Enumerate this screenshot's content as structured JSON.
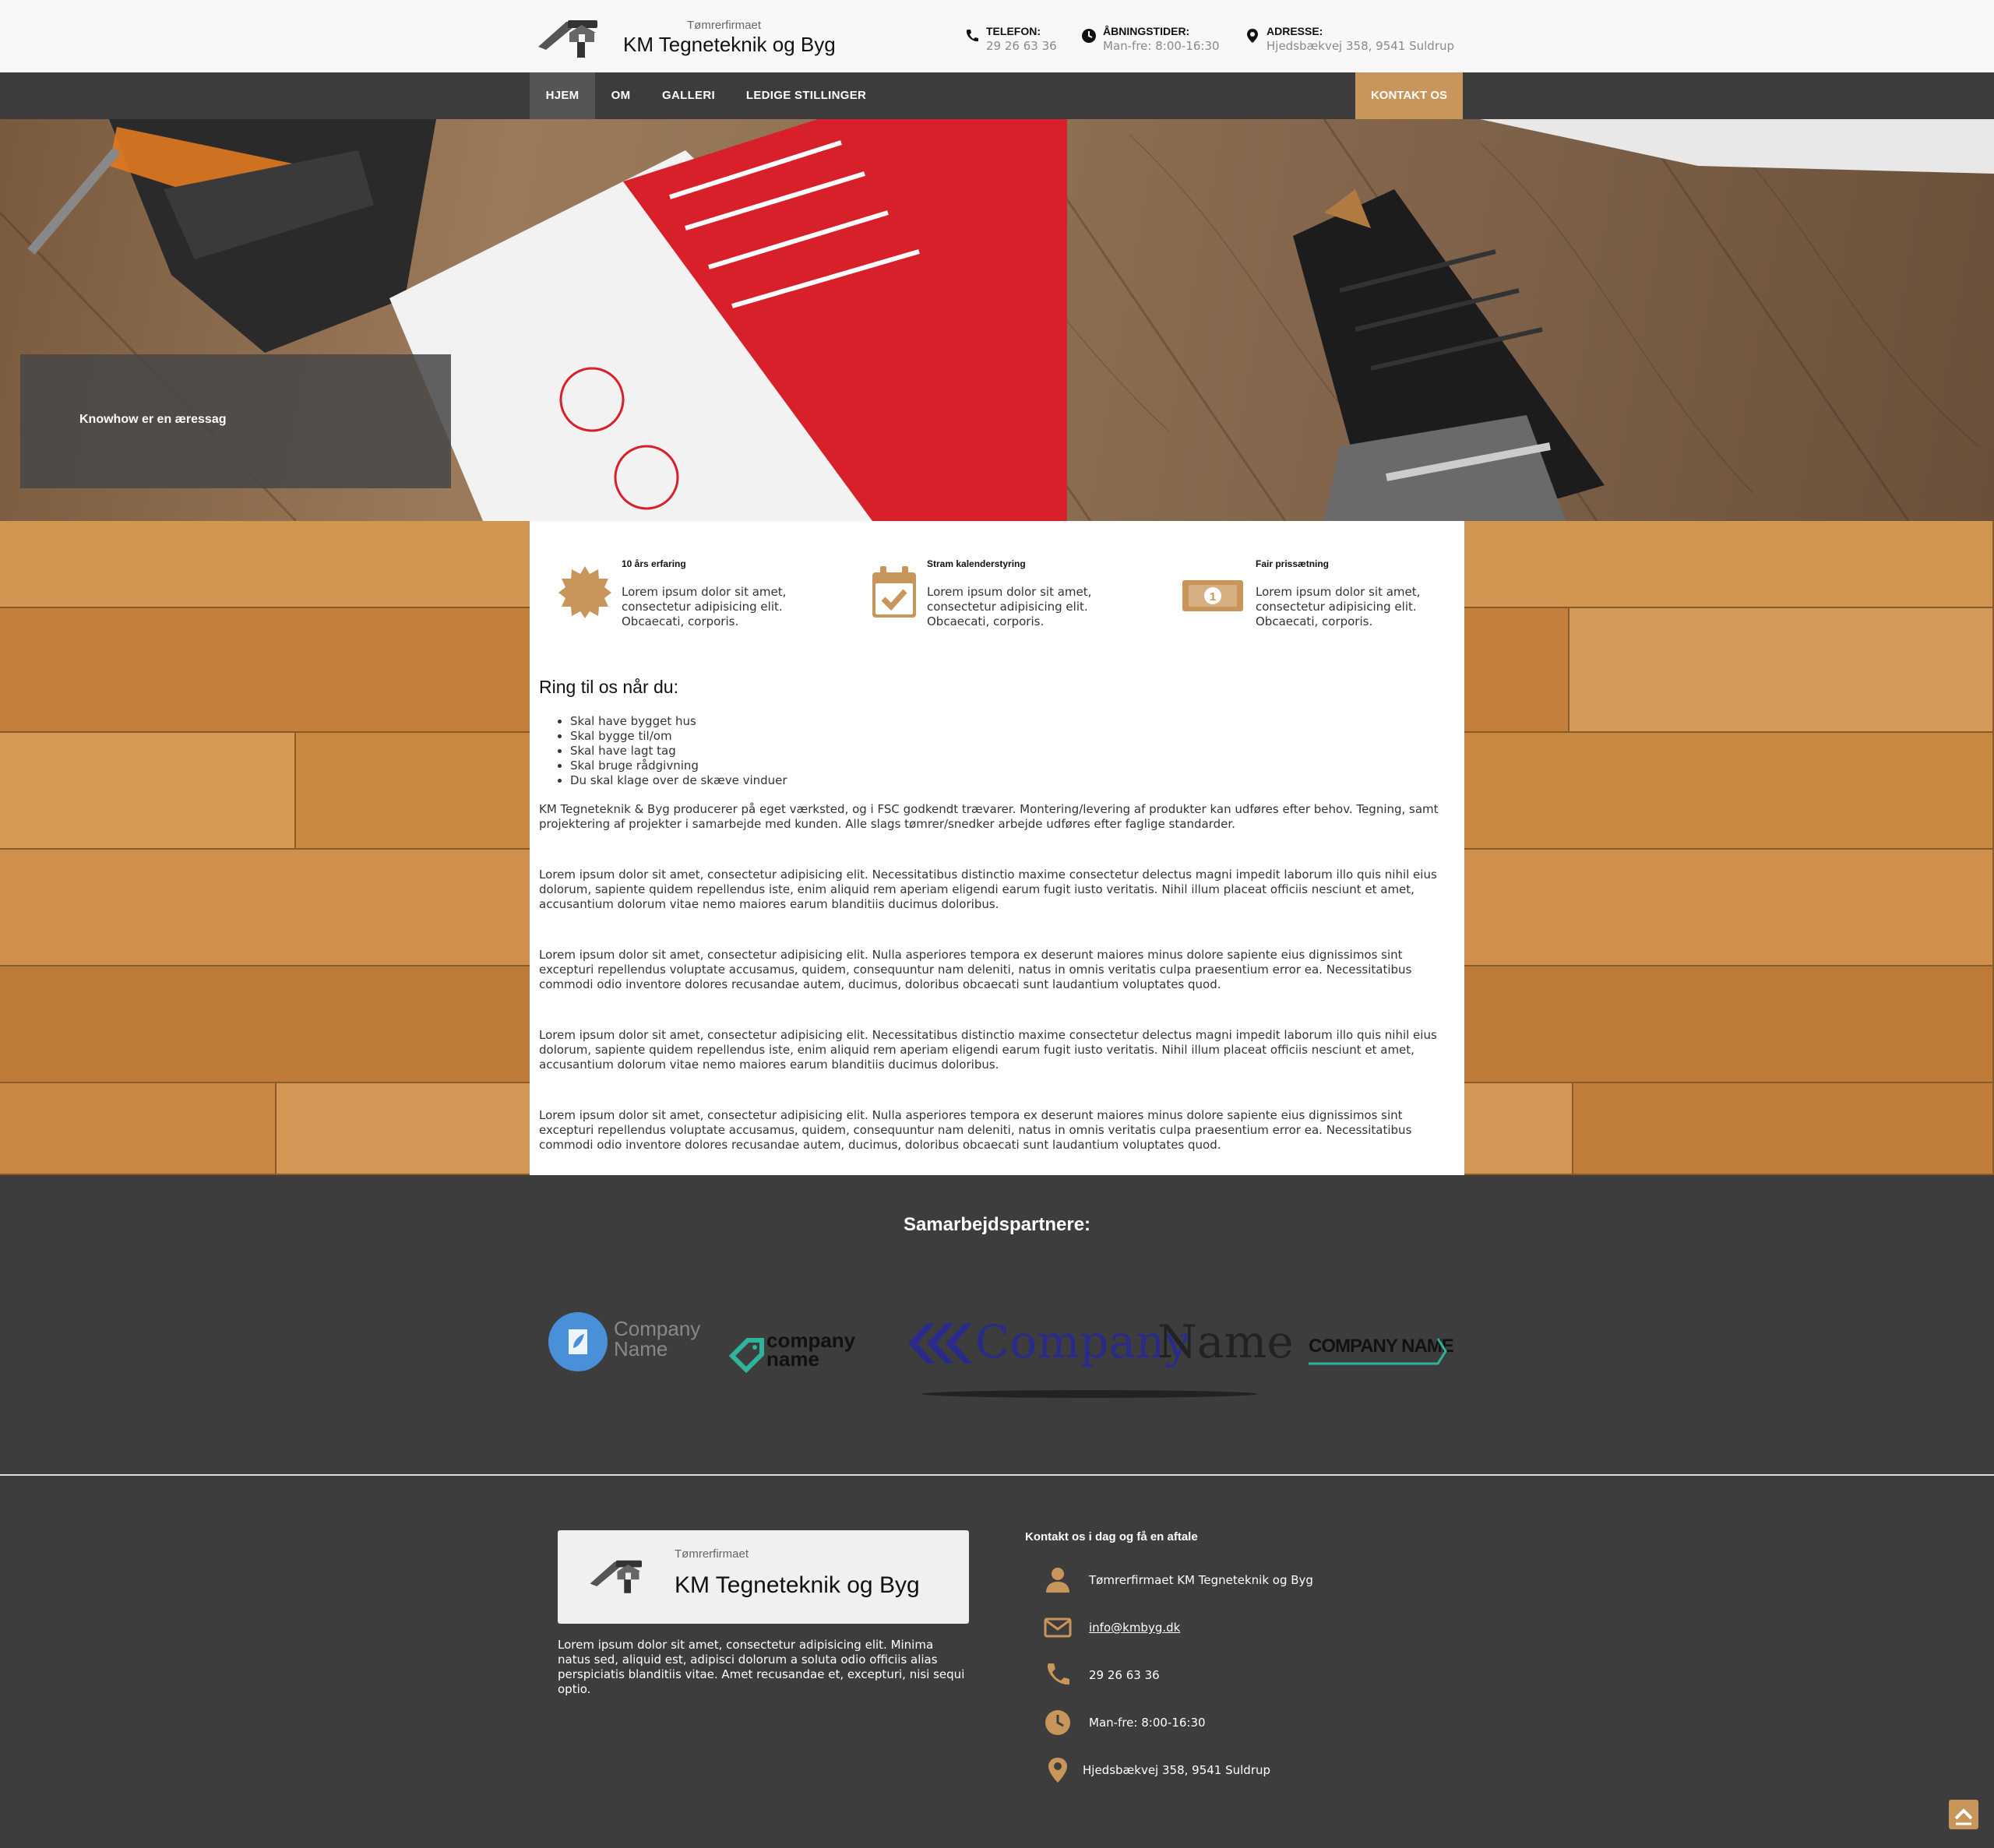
{
  "header": {
    "logo_small": "Tømrerfirmaet",
    "logo_big": "KM Tegneteknik og Byg",
    "phone_label": "TELEFON:",
    "phone_value": "29 26 63 36",
    "hours_label": "ÅBNINGSTIDER:",
    "hours_value": "Man-fre: 8:00-16:30",
    "address_label": "ADRESSE:",
    "address_value": "Hjedsbækvej 358, 9541 Suldrup"
  },
  "nav": {
    "items": [
      {
        "label": "HJEM",
        "active": true
      },
      {
        "label": "OM",
        "active": false
      },
      {
        "label": "GALLERI",
        "active": false
      },
      {
        "label": "LEDIGE STILLINGER",
        "active": false
      }
    ],
    "contact": "KONTAKT OS"
  },
  "hero": {
    "tagline": "Knowhow er en æressag"
  },
  "features": [
    {
      "title": "10 års erfaring",
      "text": "Lorem ipsum dolor sit amet, consectetur adipisicing elit. Obcaecati, corporis.",
      "icon": "badge-icon"
    },
    {
      "title": "Stram kalenderstyring",
      "text": "Lorem ipsum dolor sit amet, consectetur adipisicing elit. Obcaecati, corporis.",
      "icon": "calendar-check-icon"
    },
    {
      "title": "Fair prissætning",
      "text": "Lorem ipsum dolor sit amet, consectetur adipisicing elit. Obcaecati, corporis.",
      "icon": "money-bill-icon"
    }
  ],
  "ring": {
    "title": "Ring til os når du:",
    "items": [
      "Skal have bygget hus",
      "Skal bygge til/om",
      "Skal have lagt tag",
      "Skal bruge rådgivning",
      "Du skal klage over de skæve vinduer"
    ]
  },
  "paragraphs": [
    "KM Tegneteknik & Byg producerer på eget værksted, og i FSC godkendt trævarer. Montering/levering af produkter kan udføres efter behov. Tegning, samt projektering af projekter i samarbejde med kunden. Alle slags tømrer/snedker arbejde udføres efter faglige standarder.",
    "Lorem ipsum dolor sit amet, consectetur adipisicing elit. Necessitatibus distinctio maxime consectetur delectus magni impedit laborum illo quis nihil eius dolorum, sapiente quidem repellendus iste, enim aliquid rem aperiam eligendi earum fugit iusto veritatis. Nihil illum placeat officiis nesciunt et amet, accusantium dolorum vitae nemo maiores earum blanditiis ducimus doloribus.",
    "Lorem ipsum dolor sit amet, consectetur adipisicing elit. Nulla asperiores tempora ex deserunt maiores minus dolore sapiente eius dignissimos sint excepturi repellendus voluptate accusamus, quidem, consequuntur nam deleniti, natus in omnis veritatis culpa praesentium error ea. Necessitatibus commodi odio inventore dolores recusandae autem, ducimus, doloribus obcaecati sunt laudantium voluptates quod.",
    "Lorem ipsum dolor sit amet, consectetur adipisicing elit. Necessitatibus distinctio maxime consectetur delectus magni impedit laborum illo quis nihil eius dolorum, sapiente quidem repellendus iste, enim aliquid rem aperiam eligendi earum fugit iusto veritatis. Nihil illum placeat officiis nesciunt et amet, accusantium dolorum vitae nemo maiores earum blanditiis ducimus doloribus.",
    "Lorem ipsum dolor sit amet, consectetur adipisicing elit. Nulla asperiores tempora ex deserunt maiores minus dolore sapiente eius dignissimos sint excepturi repellendus voluptate accusamus, quidem, consequuntur nam deleniti, natus in omnis veritatis culpa praesentium error ea. Necessitatibus commodi odio inventore dolores recusandae autem, ducimus, doloribus obcaecati sunt laudantium voluptates quod."
  ],
  "partners": {
    "title": "Samarbejdspartnere:",
    "logos": [
      {
        "line1": "Company",
        "line2": "Name"
      },
      {
        "line1": "company",
        "line2": "name"
      },
      {
        "line1": "Company",
        "line2": "Name"
      },
      {
        "line1": "COMPANY NAME"
      }
    ]
  },
  "footer": {
    "logo_small": "Tømrerfirmaet",
    "logo_big": "KM Tegneteknik og Byg",
    "description": "Lorem ipsum dolor sit amet, consectetur adipisicing elit. Minima natus sed, aliquid est, adipisci dolorum a soluta odio officiis alias perspiciatis blanditiis vitae. Amet recusandae et, excepturi, nisi sequi optio.",
    "contact_title": "Kontakt os i dag og få en aftale",
    "contact": {
      "name": "Tømrerfirmaet KM Tegneteknik og Byg",
      "email": "info@kmbyg.dk",
      "phone": "29 26 63 36",
      "hours": "Man-fre: 8:00-16:30",
      "address": "Hjedsbækvej 358, 9541 Suldrup"
    }
  },
  "colors": {
    "accent": "#c8955a",
    "nav_bg": "#3c3c3c",
    "footer_bg": "#3d3d3d"
  }
}
